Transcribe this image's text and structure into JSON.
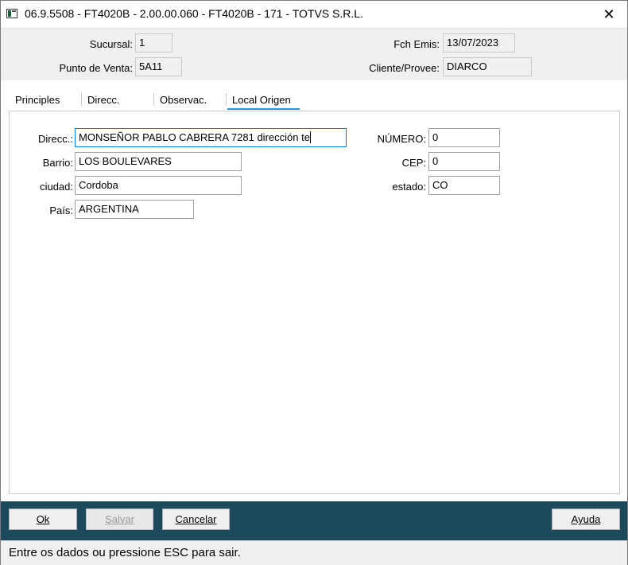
{
  "window": {
    "title": "06.9.5508 - FT4020B - 2.00.00.060 - FT4020B - 171 - TOTVS S.R.L.",
    "close_glyph": "✕"
  },
  "header": {
    "sucursal_label": "Sucursal:",
    "sucursal_value": "1",
    "punto_venta_label": "Punto de Venta:",
    "punto_venta_value": "5A11",
    "fch_emis_label": "Fch Emis:",
    "fch_emis_value": "13/07/2023",
    "cliente_label": "Cliente/Provee:",
    "cliente_value": "DIARCO"
  },
  "tabs": [
    {
      "label": "Principles",
      "active": false
    },
    {
      "label": "Direcc.",
      "active": false
    },
    {
      "label": "Observac.",
      "active": false
    },
    {
      "label": "Local Origen",
      "active": true
    }
  ],
  "form": {
    "direcc_label": "Direcc.:",
    "direcc_value": "MONSEÑOR PABLO CABRERA 7281 dirección te",
    "barrio_label": "Barrio:",
    "barrio_value": "LOS BOULEVARES",
    "ciudad_label": "ciudad:",
    "ciudad_value": "Cordoba",
    "pais_label": "País:",
    "pais_value": "ARGENTINA",
    "numero_label": "NÚMERO:",
    "numero_value": "0",
    "cep_label": "CEP:",
    "cep_value": "0",
    "estado_label": "estado:",
    "estado_value": "CO"
  },
  "buttons": {
    "ok": "Ok",
    "salvar": "Salvar",
    "cancelar": "Cancelar",
    "ayuda": "Ayuda"
  },
  "status": {
    "text": "Entre os dados ou pressione ESC para sair."
  },
  "colors": {
    "button_bar": "#1a4a5c",
    "tab_accent": "#1f9ad6",
    "focus_border": "#0078d7"
  }
}
